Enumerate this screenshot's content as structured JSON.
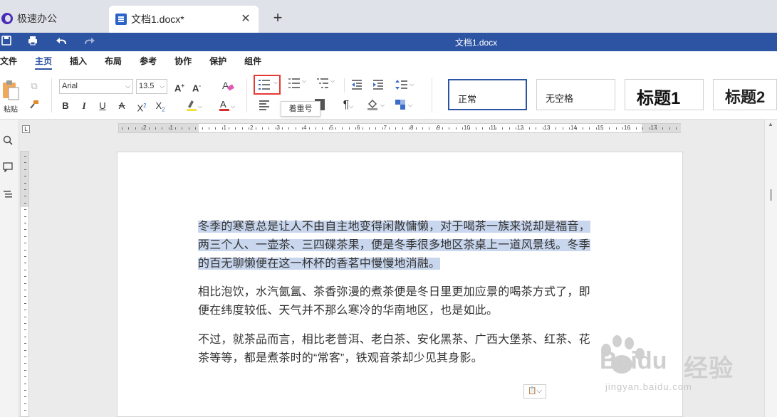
{
  "tabs": [
    {
      "label": "极速办公"
    },
    {
      "label": "文档1.docx*",
      "close": "✕"
    }
  ],
  "tab_add": "+",
  "window": {
    "title": "文档1.docx"
  },
  "menu": [
    "文件",
    "主页",
    "插入",
    "布局",
    "参考",
    "协作",
    "保护",
    "组件"
  ],
  "active_menu": "主页",
  "ribbon": {
    "paste_label": "粘贴",
    "font_name": "Arial",
    "font_size": "13.5",
    "styles": [
      "正常",
      "无空格",
      "标题1",
      "标题2"
    ],
    "tooltip": "着重号"
  },
  "ruler": {
    "numbers": [
      "2",
      "1",
      "1",
      "2",
      "3",
      "4",
      "5",
      "6",
      "7",
      "8",
      "9",
      "10",
      "11",
      "12",
      "13",
      "14",
      "15",
      "16",
      "17"
    ]
  },
  "document": {
    "paragraphs": [
      {
        "lines": [
          "冬季的寒意总是让人不由自主地变得闲散慵懒，对于喝茶一族来说却是福音，",
          "两三个人、一壶茶、三四碟茶果，便是冬季很多地区茶桌上一道风景线。冬季",
          "的百无聊懒便在这一杯杯的香茗中慢慢地消融。"
        ],
        "selected": true
      },
      {
        "lines": [
          "相比泡饮，水汽氤氲、茶香弥漫的煮茶便是冬日里更加应景的喝茶方式了，即",
          "便在纬度较低、天气并不那么寒冷的华南地区，也是如此。"
        ],
        "selected": false
      },
      {
        "lines": [
          "不过，就茶品而言，相比老普洱、老白茶、安化黑茶、广西大堡茶、红茶、花",
          "茶等等，都是煮茶时的“常客”，铁观音茶却少见其身影。"
        ],
        "selected": false
      }
    ]
  },
  "watermark": {
    "brand": "Bai",
    "brand2": "du",
    "cn": "经验",
    "url": "jingyan.baidu.com"
  },
  "colors": {
    "accent": "#2d54a3",
    "highlight_box": "#e53935",
    "selection": "#c8d6ee"
  }
}
